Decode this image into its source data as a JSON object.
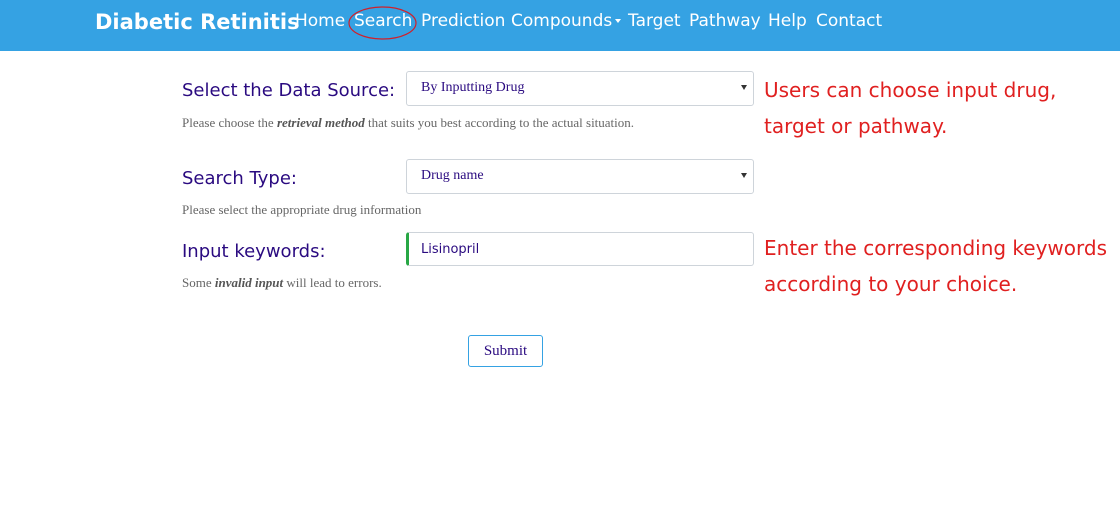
{
  "navbar": {
    "brand": "Diabetic Retinitis",
    "items": [
      {
        "label": "Home"
      },
      {
        "label": "Search",
        "highlighted": true
      },
      {
        "label": "Prediction"
      },
      {
        "label": "Compounds",
        "dropdown": true
      },
      {
        "label": "Target"
      },
      {
        "label": "Pathway"
      },
      {
        "label": "Help"
      },
      {
        "label": "Contact"
      }
    ],
    "background_color": "#35a2e3"
  },
  "form": {
    "data_source": {
      "label": "Select the Data Source:",
      "selected": "By Inputting Drug",
      "help_prefix": "Please choose the ",
      "help_emphasis": "retrieval method",
      "help_suffix": " that suits you best according to the actual situation."
    },
    "search_type": {
      "label": "Search Type:",
      "selected": "Drug name",
      "help": "Please select the appropriate drug information"
    },
    "keywords": {
      "label": "Input keywords:",
      "value": "Lisinopril",
      "help_prefix": "Some ",
      "help_emphasis": "invalid input",
      "help_suffix": " will lead to errors."
    },
    "submit_label": "Submit"
  },
  "annotations": {
    "note1_line1": "Users can choose input drug,",
    "note1_line2": "target or pathway.",
    "note2_line1": "Enter the corresponding keywords",
    "note2_line2": "according to your choice.",
    "color": "#e02020"
  }
}
